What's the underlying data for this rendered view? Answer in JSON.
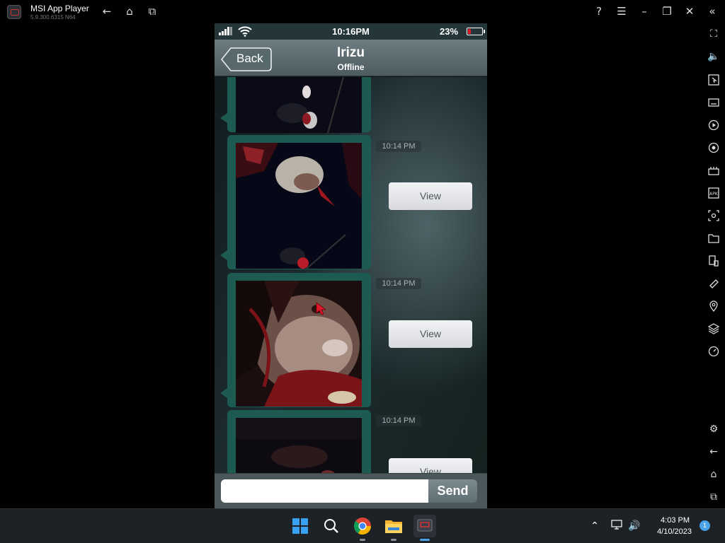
{
  "emulator": {
    "title": "MSI App Player",
    "version": "5.9.300.6315 N64"
  },
  "phone": {
    "status": {
      "time": "10:16PM",
      "battery": "23%",
      "battery_fraction": 0.23
    },
    "header": {
      "back_label": "Back",
      "contact_name": "Irizu",
      "contact_status": "Offline"
    },
    "messages": [
      {
        "timestamp": "10:14 PM",
        "view_label": ""
      },
      {
        "timestamp": "10:14 PM",
        "view_label": "View"
      },
      {
        "timestamp": "10:14 PM",
        "view_label": "View"
      },
      {
        "timestamp": "",
        "view_label": "View"
      }
    ],
    "composer": {
      "input_value": "",
      "placeholder": "",
      "send_label": "Send"
    }
  },
  "taskbar": {
    "time": "4:03 PM",
    "date": "4/10/2023",
    "notification_count": "1"
  }
}
